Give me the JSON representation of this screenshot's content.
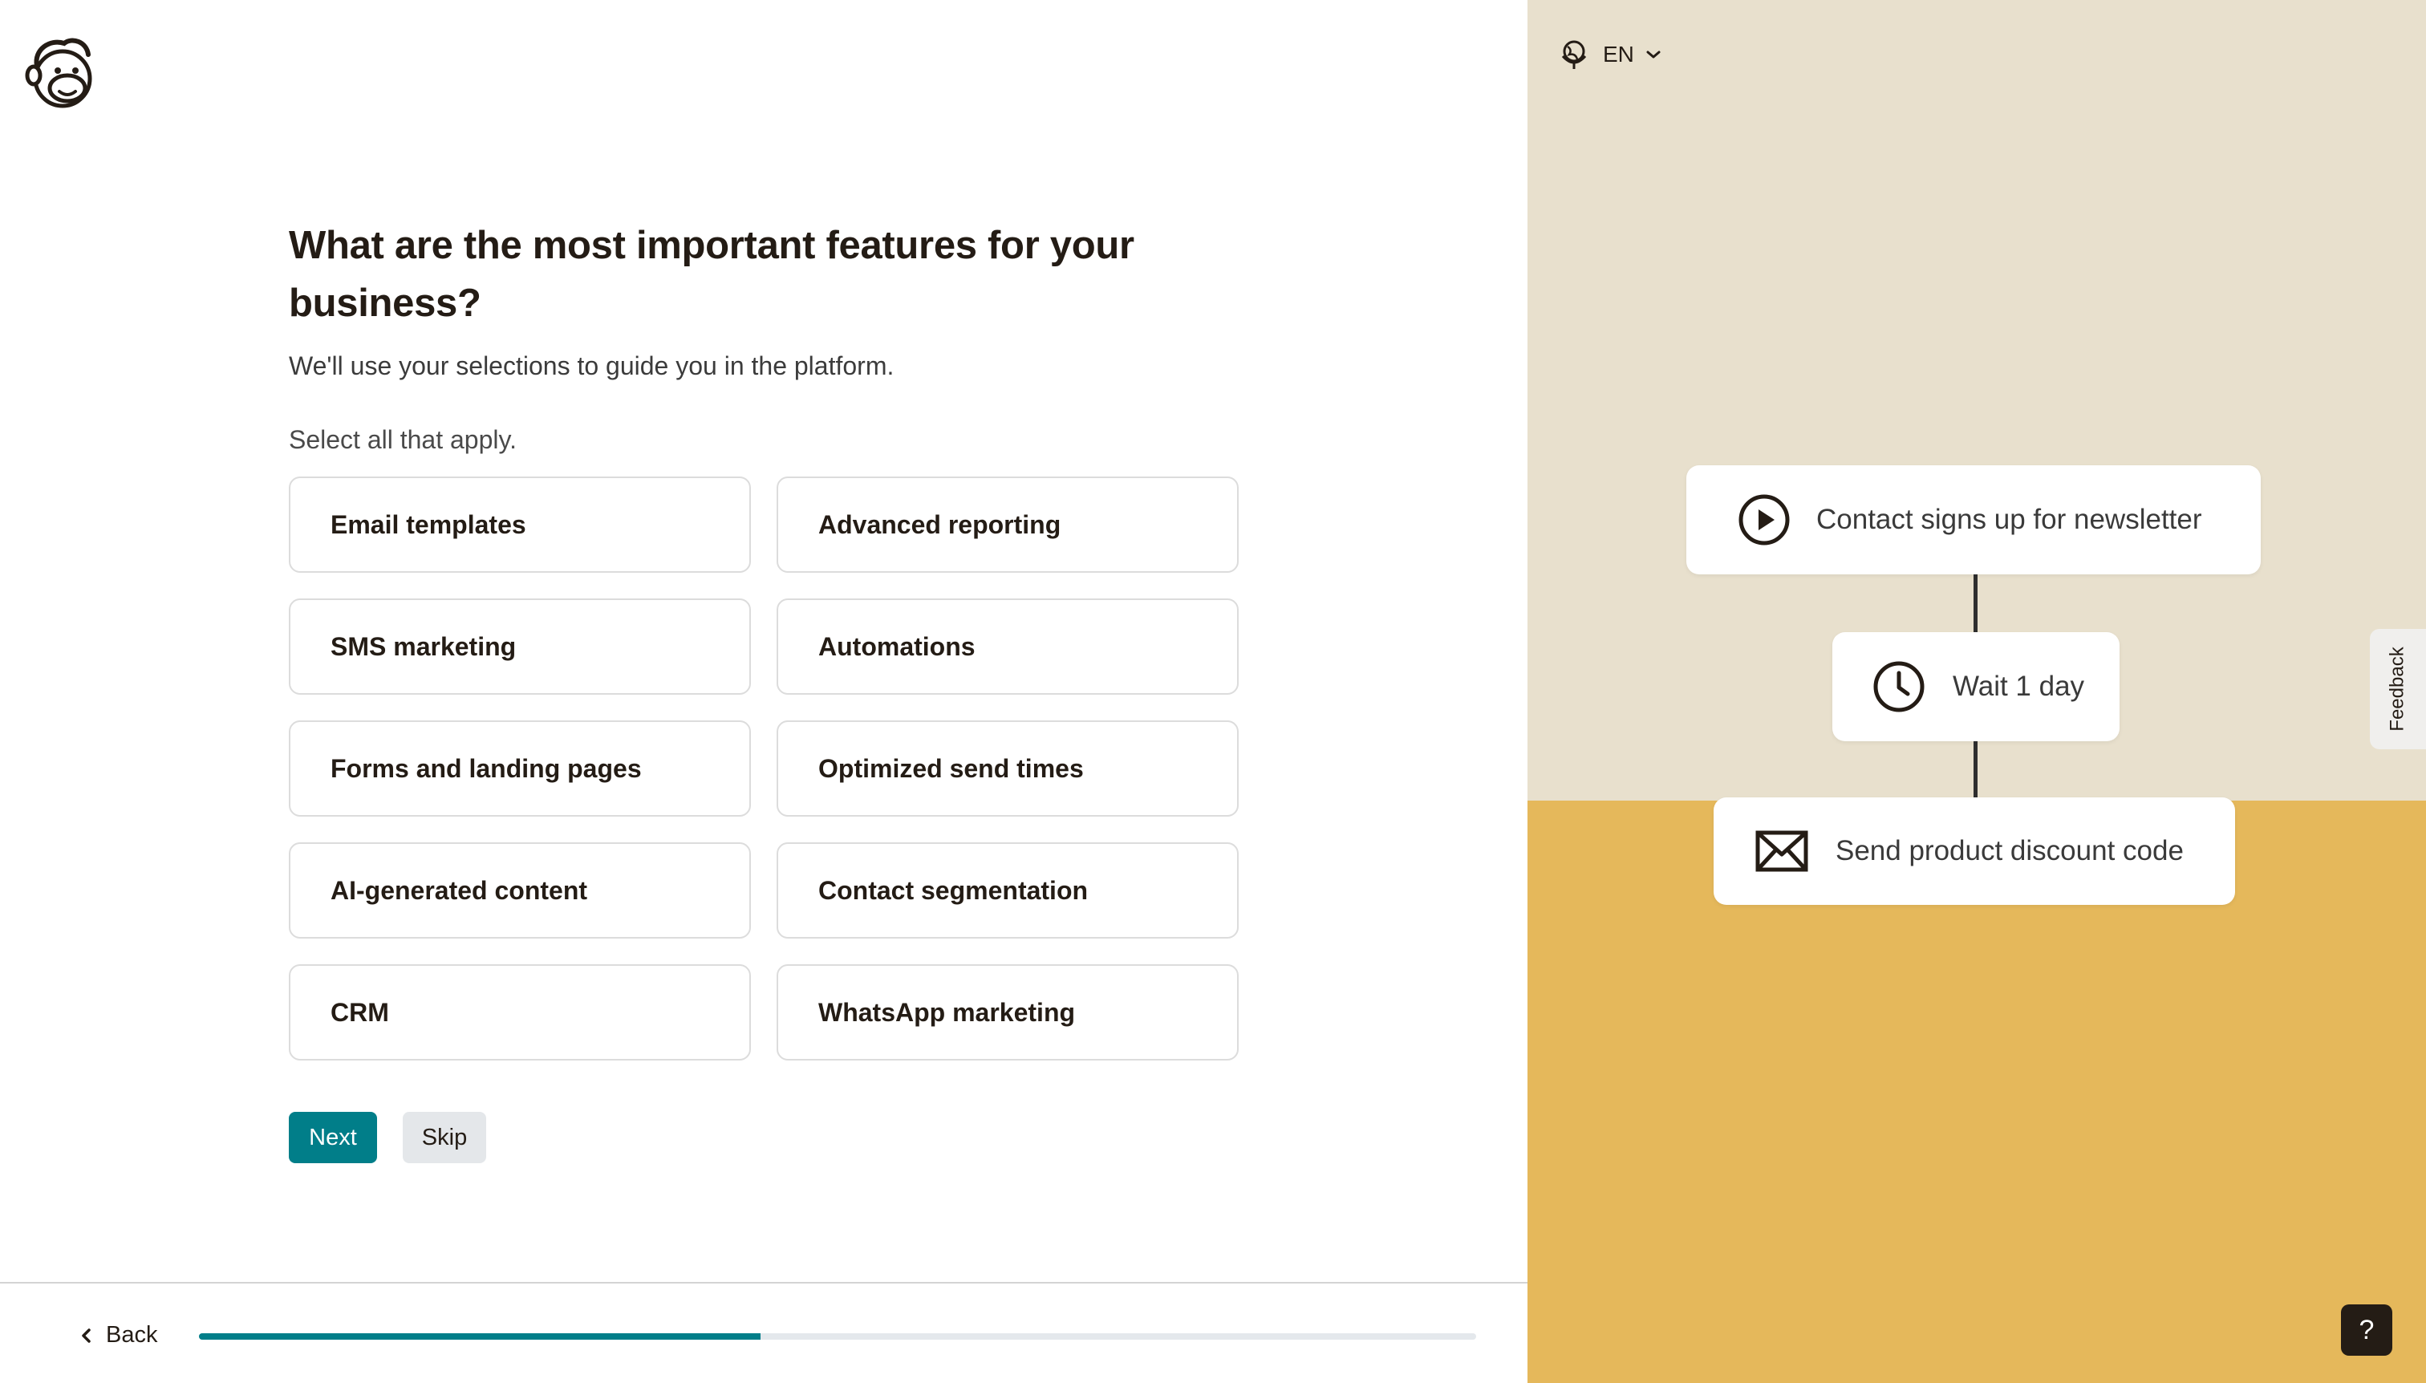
{
  "question": {
    "heading": "What are the most important features for your business?",
    "subheading": "We'll use your selections to guide you in the platform.",
    "hint": "Select all that apply."
  },
  "options": [
    "Email templates",
    "Advanced reporting",
    "SMS marketing",
    "Automations",
    "Forms and landing pages",
    "Optimized send times",
    "AI-generated content",
    "Contact segmentation",
    "CRM",
    "WhatsApp marketing"
  ],
  "actions": {
    "next": "Next",
    "skip": "Skip"
  },
  "footer": {
    "back": "Back",
    "progress_fraction": 0.44
  },
  "language": {
    "code": "EN"
  },
  "illustration": {
    "trigger": "Contact signs up for newsletter",
    "wait": "Wait 1 day",
    "action": "Send product discount code"
  },
  "feedback": "Feedback",
  "help": "?",
  "colors": {
    "brand_teal": "#017e89",
    "panel_beige": "#e8e0cd",
    "panel_gold": "#e5b85b"
  }
}
